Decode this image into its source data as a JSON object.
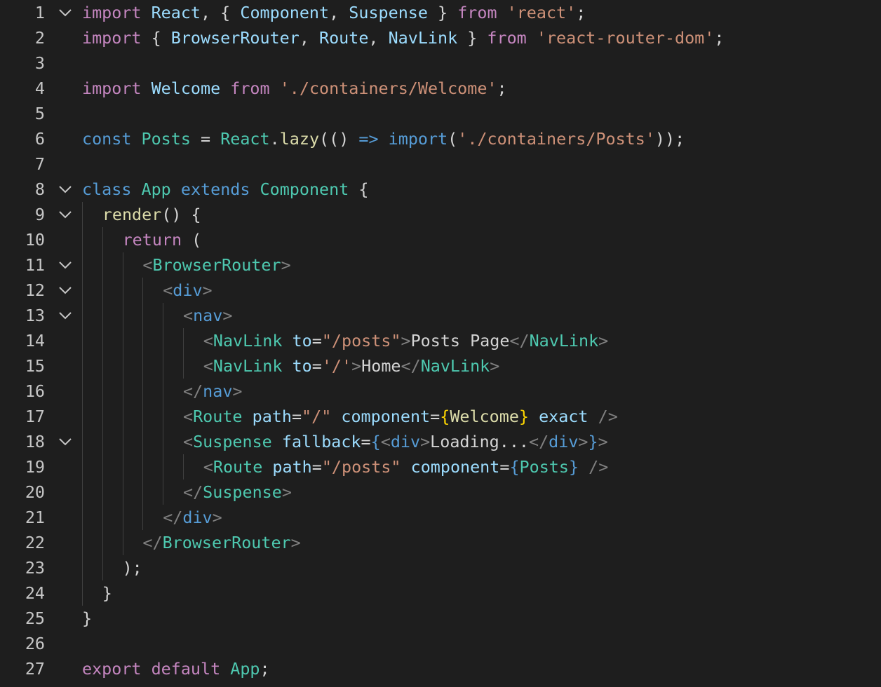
{
  "editor": {
    "language": "javascript-react",
    "colors": {
      "background": "#1e1e1e",
      "line_number": "#c6c6c6",
      "keyword": "#c586c0",
      "storage": "#569cd6",
      "class": "#4ec9b0",
      "variable": "#9cdcfe",
      "function": "#dcdcaa",
      "string": "#ce9178",
      "text": "#d4d4d4",
      "angle": "#808080"
    },
    "lines": [
      {
        "n": "1",
        "fold": true,
        "indent": 0,
        "tokens": [
          [
            "keyword",
            "import"
          ],
          [
            "text",
            " "
          ],
          [
            "var",
            "React"
          ],
          [
            "text",
            ", { "
          ],
          [
            "var",
            "Component"
          ],
          [
            "text",
            ", "
          ],
          [
            "var",
            "Suspense"
          ],
          [
            "text",
            " } "
          ],
          [
            "keyword",
            "from"
          ],
          [
            "text",
            " "
          ],
          [
            "string",
            "'react'"
          ],
          [
            "text",
            ";"
          ]
        ]
      },
      {
        "n": "2",
        "fold": false,
        "indent": 0,
        "tokens": [
          [
            "keyword",
            "import"
          ],
          [
            "text",
            " { "
          ],
          [
            "var",
            "BrowserRouter"
          ],
          [
            "text",
            ", "
          ],
          [
            "var",
            "Route"
          ],
          [
            "text",
            ", "
          ],
          [
            "var",
            "NavLink"
          ],
          [
            "text",
            " } "
          ],
          [
            "keyword",
            "from"
          ],
          [
            "text",
            " "
          ],
          [
            "string",
            "'react-router-dom'"
          ],
          [
            "text",
            ";"
          ]
        ]
      },
      {
        "n": "3",
        "fold": false,
        "indent": 0,
        "tokens": []
      },
      {
        "n": "4",
        "fold": false,
        "indent": 0,
        "tokens": [
          [
            "keyword",
            "import"
          ],
          [
            "text",
            " "
          ],
          [
            "var",
            "Welcome"
          ],
          [
            "text",
            " "
          ],
          [
            "keyword",
            "from"
          ],
          [
            "text",
            " "
          ],
          [
            "string",
            "'./containers/Welcome'"
          ],
          [
            "text",
            ";"
          ]
        ]
      },
      {
        "n": "5",
        "fold": false,
        "indent": 0,
        "tokens": []
      },
      {
        "n": "6",
        "fold": false,
        "indent": 0,
        "tokens": [
          [
            "storage",
            "const"
          ],
          [
            "text",
            " "
          ],
          [
            "class",
            "Posts"
          ],
          [
            "text",
            " = "
          ],
          [
            "class",
            "React"
          ],
          [
            "text",
            "."
          ],
          [
            "func",
            "lazy"
          ],
          [
            "text",
            "(() "
          ],
          [
            "storage",
            "=>"
          ],
          [
            "text",
            " "
          ],
          [
            "storage",
            "import"
          ],
          [
            "text",
            "("
          ],
          [
            "string",
            "'./containers/Posts'"
          ],
          [
            "text",
            "));"
          ]
        ]
      },
      {
        "n": "7",
        "fold": false,
        "indent": 0,
        "tokens": []
      },
      {
        "n": "8",
        "fold": true,
        "indent": 0,
        "tokens": [
          [
            "storage",
            "class"
          ],
          [
            "text",
            " "
          ],
          [
            "class",
            "App"
          ],
          [
            "text",
            " "
          ],
          [
            "storage",
            "extends"
          ],
          [
            "text",
            " "
          ],
          [
            "class",
            "Component"
          ],
          [
            "text",
            " {"
          ]
        ]
      },
      {
        "n": "9",
        "fold": true,
        "indent": 1,
        "tokens": [
          [
            "func",
            "render"
          ],
          [
            "text",
            "() {"
          ]
        ]
      },
      {
        "n": "10",
        "fold": false,
        "indent": 2,
        "tokens": [
          [
            "keyword",
            "return"
          ],
          [
            "text",
            " ("
          ]
        ]
      },
      {
        "n": "11",
        "fold": true,
        "indent": 3,
        "tokens": [
          [
            "angle",
            "<"
          ],
          [
            "tag",
            "BrowserRouter"
          ],
          [
            "angle",
            ">"
          ]
        ]
      },
      {
        "n": "12",
        "fold": true,
        "indent": 4,
        "tokens": [
          [
            "angle",
            "<"
          ],
          [
            "htmltag",
            "div"
          ],
          [
            "angle",
            ">"
          ]
        ]
      },
      {
        "n": "13",
        "fold": true,
        "indent": 5,
        "tokens": [
          [
            "angle",
            "<"
          ],
          [
            "htmltag",
            "nav"
          ],
          [
            "angle",
            ">"
          ]
        ]
      },
      {
        "n": "14",
        "fold": false,
        "indent": 6,
        "tokens": [
          [
            "angle",
            "<"
          ],
          [
            "tag",
            "NavLink"
          ],
          [
            "text",
            " "
          ],
          [
            "attr",
            "to"
          ],
          [
            "text",
            "="
          ],
          [
            "string",
            "\"/posts\""
          ],
          [
            "angle",
            ">"
          ],
          [
            "text",
            "Posts Page"
          ],
          [
            "angle",
            "</"
          ],
          [
            "tag",
            "NavLink"
          ],
          [
            "angle",
            ">"
          ]
        ]
      },
      {
        "n": "15",
        "fold": false,
        "indent": 6,
        "tokens": [
          [
            "angle",
            "<"
          ],
          [
            "tag",
            "NavLink"
          ],
          [
            "text",
            " "
          ],
          [
            "attr",
            "to"
          ],
          [
            "text",
            "="
          ],
          [
            "string",
            "'/'"
          ],
          [
            "angle",
            ">"
          ],
          [
            "text",
            "Home"
          ],
          [
            "angle",
            "</"
          ],
          [
            "tag",
            "NavLink"
          ],
          [
            "angle",
            ">"
          ]
        ]
      },
      {
        "n": "16",
        "fold": false,
        "indent": 5,
        "tokens": [
          [
            "angle",
            "</"
          ],
          [
            "htmltag",
            "nav"
          ],
          [
            "angle",
            ">"
          ]
        ]
      },
      {
        "n": "17",
        "fold": false,
        "indent": 5,
        "tokens": [
          [
            "angle",
            "<"
          ],
          [
            "tag",
            "Route"
          ],
          [
            "text",
            " "
          ],
          [
            "attr",
            "path"
          ],
          [
            "text",
            "="
          ],
          [
            "string",
            "\"/\""
          ],
          [
            "text",
            " "
          ],
          [
            "attr",
            "component"
          ],
          [
            "text",
            "="
          ],
          [
            "brace2",
            "{"
          ],
          [
            "func",
            "Welcome"
          ],
          [
            "brace2",
            "}"
          ],
          [
            "text",
            " "
          ],
          [
            "attr",
            "exact"
          ],
          [
            "text",
            " "
          ],
          [
            "angle",
            "/>"
          ]
        ]
      },
      {
        "n": "18",
        "fold": true,
        "indent": 5,
        "tokens": [
          [
            "angle",
            "<"
          ],
          [
            "tag",
            "Suspense"
          ],
          [
            "text",
            " "
          ],
          [
            "attr",
            "fallback"
          ],
          [
            "text",
            "="
          ],
          [
            "brace",
            "{"
          ],
          [
            "angle",
            "<"
          ],
          [
            "htmltag",
            "div"
          ],
          [
            "angle",
            ">"
          ],
          [
            "text",
            "Loading..."
          ],
          [
            "angle",
            "</"
          ],
          [
            "htmltag",
            "div"
          ],
          [
            "angle",
            ">"
          ],
          [
            "brace",
            "}"
          ],
          [
            "angle",
            ">"
          ]
        ]
      },
      {
        "n": "19",
        "fold": false,
        "indent": 6,
        "tokens": [
          [
            "angle",
            "<"
          ],
          [
            "tag",
            "Route"
          ],
          [
            "text",
            " "
          ],
          [
            "attr",
            "path"
          ],
          [
            "text",
            "="
          ],
          [
            "string",
            "\"/posts\""
          ],
          [
            "text",
            " "
          ],
          [
            "attr",
            "component"
          ],
          [
            "text",
            "="
          ],
          [
            "brace",
            "{"
          ],
          [
            "class",
            "Posts"
          ],
          [
            "brace",
            "}"
          ],
          [
            "text",
            " "
          ],
          [
            "angle",
            "/>"
          ]
        ]
      },
      {
        "n": "20",
        "fold": false,
        "indent": 5,
        "tokens": [
          [
            "angle",
            "</"
          ],
          [
            "tag",
            "Suspense"
          ],
          [
            "angle",
            ">"
          ]
        ]
      },
      {
        "n": "21",
        "fold": false,
        "indent": 4,
        "tokens": [
          [
            "angle",
            "</"
          ],
          [
            "htmltag",
            "div"
          ],
          [
            "angle",
            ">"
          ]
        ]
      },
      {
        "n": "22",
        "fold": false,
        "indent": 3,
        "tokens": [
          [
            "angle",
            "</"
          ],
          [
            "tag",
            "BrowserRouter"
          ],
          [
            "angle",
            ">"
          ]
        ]
      },
      {
        "n": "23",
        "fold": false,
        "indent": 2,
        "tokens": [
          [
            "text",
            ");"
          ]
        ]
      },
      {
        "n": "24",
        "fold": false,
        "indent": 1,
        "tokens": [
          [
            "text",
            "}"
          ]
        ]
      },
      {
        "n": "25",
        "fold": false,
        "indent": 0,
        "tokens": [
          [
            "text",
            "}"
          ]
        ]
      },
      {
        "n": "26",
        "fold": false,
        "indent": 0,
        "tokens": []
      },
      {
        "n": "27",
        "fold": false,
        "indent": 0,
        "tokens": [
          [
            "keyword",
            "export"
          ],
          [
            "text",
            " "
          ],
          [
            "keyword",
            "default"
          ],
          [
            "text",
            " "
          ],
          [
            "class",
            "App"
          ],
          [
            "text",
            ";"
          ]
        ]
      }
    ]
  }
}
